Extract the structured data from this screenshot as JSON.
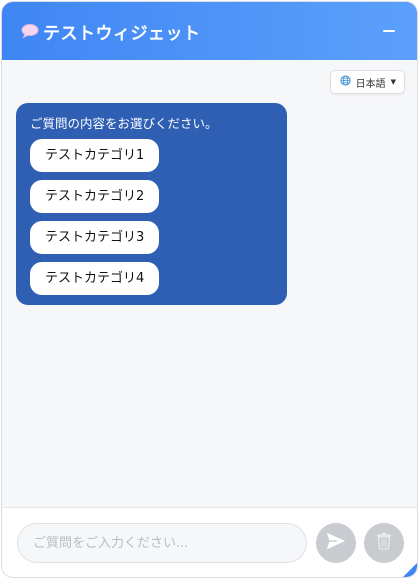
{
  "header": {
    "title": "テストウィジェット",
    "icon": "speech-bubble-icon",
    "minimize_icon": "minimize-icon"
  },
  "language": {
    "selected": "日本語",
    "icon": "globe-icon"
  },
  "bot_message": {
    "prompt": "ご質問の内容をお選びください。",
    "options": [
      {
        "label": "テストカテゴリ1"
      },
      {
        "label": "テストカテゴリ2"
      },
      {
        "label": "テストカテゴリ3"
      },
      {
        "label": "テストカテゴリ4"
      }
    ]
  },
  "composer": {
    "placeholder": "ご質問をご入力ください...",
    "value": "",
    "send_icon": "send-icon",
    "clear_icon": "trash-icon"
  },
  "colors": {
    "header_start": "#3f86f4",
    "header_end": "#5ba0fb",
    "bot_bubble": "#2f5fb3",
    "disabled_button": "#c8cbd0"
  }
}
